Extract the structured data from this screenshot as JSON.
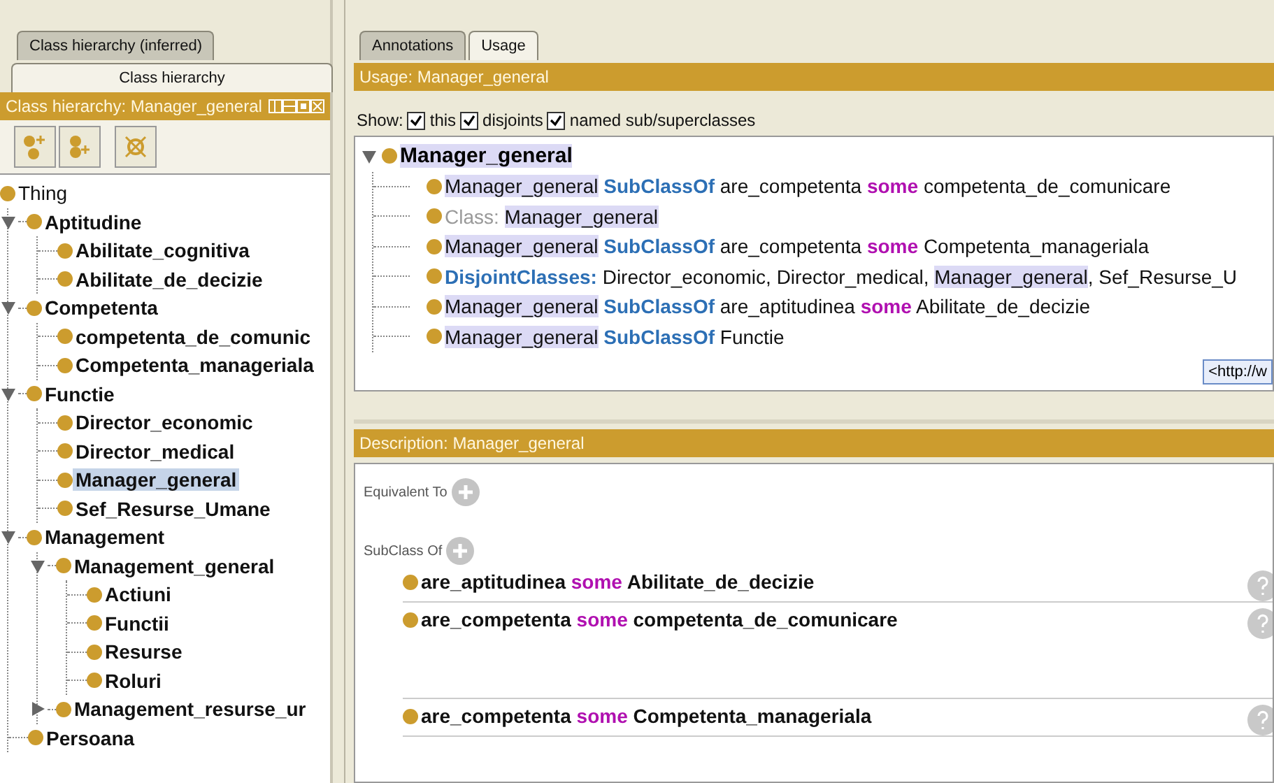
{
  "left_panel": {
    "tabs": [
      {
        "label": "Class hierarchy (inferred)",
        "selected": false
      },
      {
        "label": "Class hierarchy",
        "selected": true
      }
    ],
    "header": "Class hierarchy: Manager_general",
    "tree": [
      {
        "label": "Thing",
        "selected": false,
        "children": [
          {
            "label": "Aptitudine",
            "selected": false,
            "expanded": true,
            "children": [
              {
                "label": "Abilitate_cognitiva",
                "selected": false
              },
              {
                "label": "Abilitate_de_decizie",
                "selected": false
              }
            ]
          },
          {
            "label": "Competenta",
            "selected": false,
            "expanded": true,
            "children": [
              {
                "label": "competenta_de_comunic",
                "selected": false
              },
              {
                "label": "Competenta_manageriala",
                "selected": false
              }
            ]
          },
          {
            "label": "Functie",
            "selected": false,
            "expanded": true,
            "children": [
              {
                "label": "Director_economic",
                "selected": false
              },
              {
                "label": "Director_medical",
                "selected": false
              },
              {
                "label": "Manager_general",
                "selected": true
              },
              {
                "label": "Sef_Resurse_Umane",
                "selected": false
              }
            ]
          },
          {
            "label": "Management",
            "selected": false,
            "expanded": true,
            "children": [
              {
                "label": "Management_general",
                "selected": false,
                "expanded": true,
                "children": [
                  {
                    "label": "Actiuni",
                    "selected": false
                  },
                  {
                    "label": "Functii",
                    "selected": false
                  },
                  {
                    "label": "Resurse",
                    "selected": false
                  },
                  {
                    "label": "Roluri",
                    "selected": false
                  }
                ]
              },
              {
                "label": "Management_resurse_ur",
                "selected": false,
                "expanded": false
              }
            ]
          },
          {
            "label": "Persoana",
            "selected": false
          }
        ]
      }
    ]
  },
  "right_panel": {
    "tabs": [
      {
        "label": "Annotations",
        "selected": false
      },
      {
        "label": "Usage",
        "selected": true
      }
    ],
    "usage_header": "Usage: Manager_general",
    "show_label": "Show:",
    "show_options": [
      {
        "label": "this",
        "checked": true
      },
      {
        "label": "disjoints",
        "checked": true
      },
      {
        "label": "named sub/superclasses",
        "checked": true
      }
    ],
    "usage_root": "Manager_general",
    "usage_rows": [
      {
        "segments": [
          {
            "kind": "name",
            "text": "Manager_general"
          },
          {
            "kind": "keyword",
            "text": "SubClassOf"
          },
          {
            "kind": "plain",
            "text": "are_competenta"
          },
          {
            "kind": "some",
            "text": "some"
          },
          {
            "kind": "plain",
            "text": "competenta_de_comunicare"
          }
        ]
      },
      {
        "segments": [
          {
            "kind": "label",
            "text": "Class:"
          },
          {
            "kind": "name",
            "text": "Manager_general"
          }
        ]
      },
      {
        "segments": [
          {
            "kind": "name",
            "text": "Manager_general"
          },
          {
            "kind": "keyword",
            "text": "SubClassOf"
          },
          {
            "kind": "plain",
            "text": "are_competenta"
          },
          {
            "kind": "some",
            "text": "some"
          },
          {
            "kind": "plain",
            "text": "Competenta_manageriala"
          }
        ]
      },
      {
        "segments": [
          {
            "kind": "keyword",
            "text": "DisjointClasses:"
          },
          {
            "kind": "plain",
            "text": "Director_economic, Director_medical,"
          },
          {
            "kind": "name",
            "text": "Manager_general"
          },
          {
            "kind": "plain",
            "text": ", Sef_Resurse_U"
          }
        ]
      },
      {
        "segments": [
          {
            "kind": "name",
            "text": "Manager_general"
          },
          {
            "kind": "keyword",
            "text": "SubClassOf"
          },
          {
            "kind": "plain",
            "text": "are_aptitudinea"
          },
          {
            "kind": "some",
            "text": "some"
          },
          {
            "kind": "plain",
            "text": "Abilitate_de_decizie"
          }
        ]
      },
      {
        "segments": [
          {
            "kind": "name",
            "text": "Manager_general"
          },
          {
            "kind": "keyword",
            "text": "SubClassOf"
          },
          {
            "kind": "plain",
            "text": "Functie"
          }
        ]
      }
    ],
    "tooltip": "<http://w",
    "description_header": "Description: Manager_general",
    "sections": [
      {
        "label": "Equivalent To"
      },
      {
        "label": "SubClass Of",
        "rows": [
          {
            "segments": [
              {
                "kind": "plain",
                "text": "are_aptitudinea"
              },
              {
                "kind": "some",
                "text": "some"
              },
              {
                "kind": "plain",
                "text": "Abilitate_de_decizie"
              }
            ]
          },
          {
            "segments": [
              {
                "kind": "plain",
                "text": "are_competenta"
              },
              {
                "kind": "some",
                "text": "some"
              },
              {
                "kind": "plain",
                "text": "competenta_de_comunicare"
              }
            ],
            "tall": true
          },
          {
            "segments": [
              {
                "kind": "plain",
                "text": "are_competenta"
              },
              {
                "kind": "some",
                "text": "some"
              },
              {
                "kind": "plain",
                "text": "Competenta_manageriala"
              }
            ]
          }
        ]
      }
    ]
  }
}
